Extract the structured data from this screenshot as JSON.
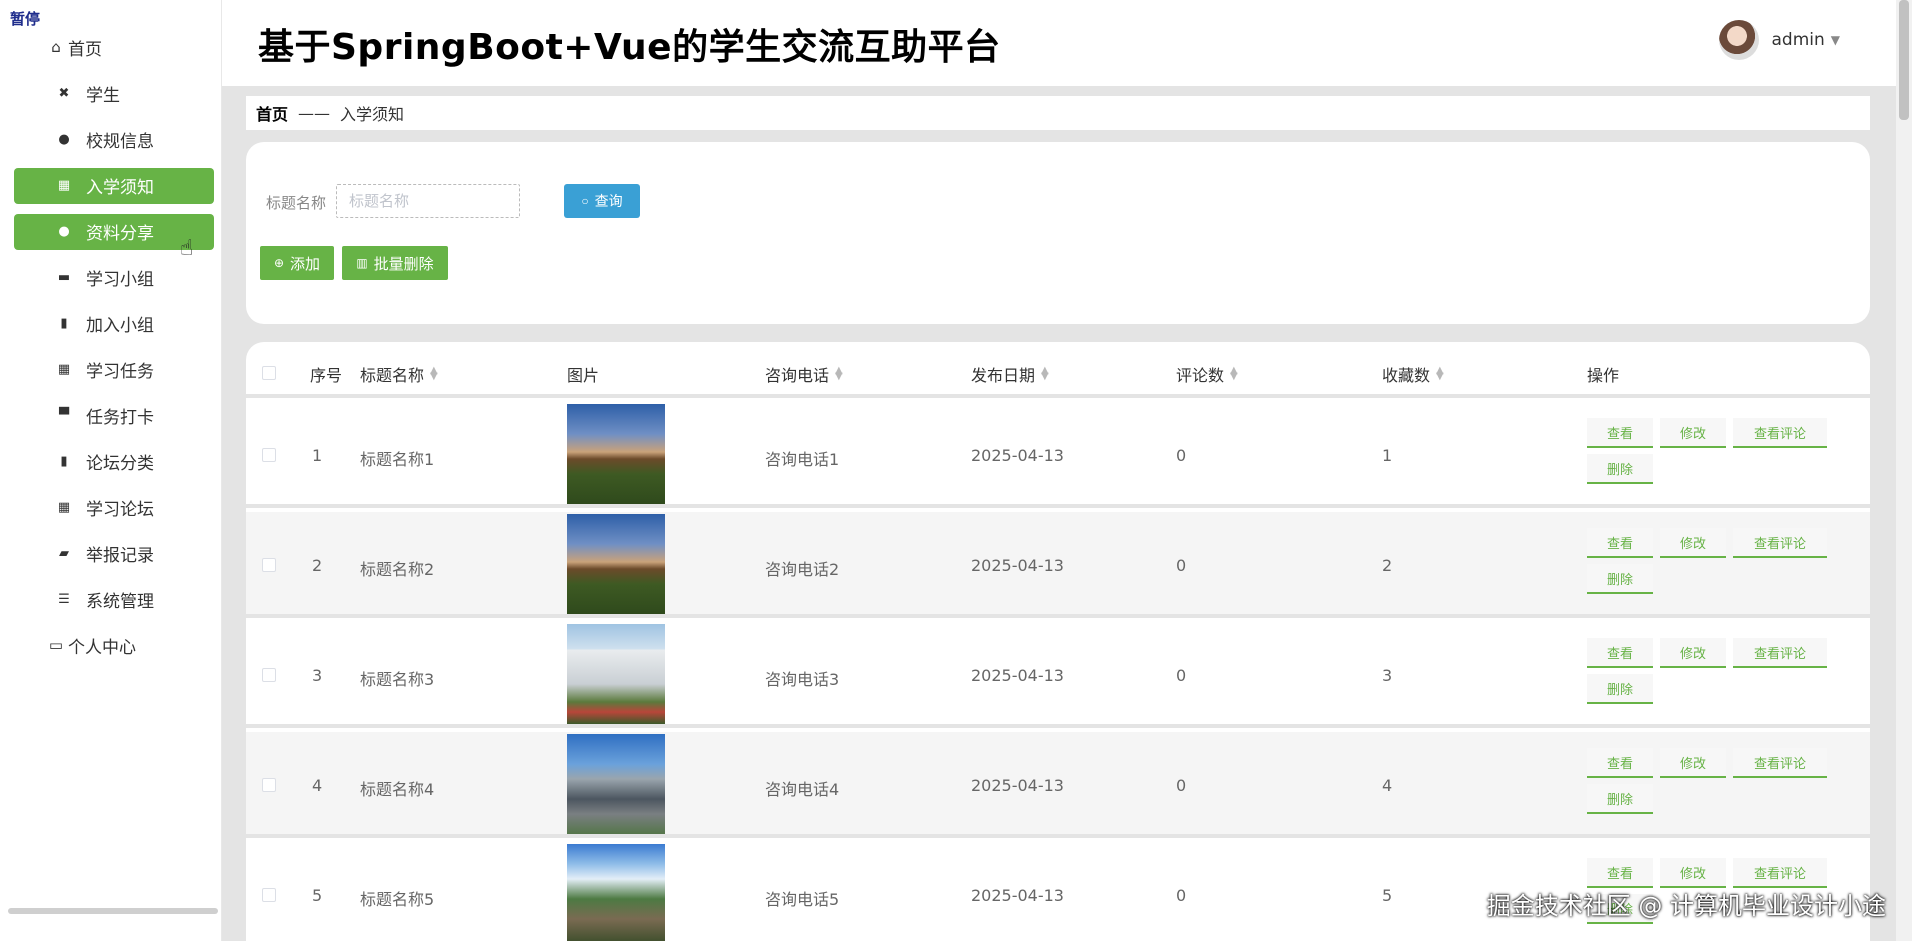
{
  "status_tag": "暂停",
  "header": {
    "title": "基于SpringBoot+Vue的学生交流互助平台",
    "user": "admin"
  },
  "sidebar": {
    "items": [
      {
        "label": "首页",
        "icon": "home-icon",
        "glyph": "⌂",
        "kind": "top"
      },
      {
        "label": "学生",
        "icon": "ticket-icon",
        "glyph": "✖",
        "kind": "sub"
      },
      {
        "label": "校规信息",
        "icon": "person-icon",
        "glyph": "●",
        "kind": "sub"
      },
      {
        "label": "入学须知",
        "icon": "grid-icon",
        "glyph": "▦",
        "kind": "sub",
        "active": true
      },
      {
        "label": "资料分享",
        "icon": "bulb-icon",
        "glyph": "●",
        "kind": "sub",
        "active": true
      },
      {
        "label": "学习小组",
        "icon": "briefcase-icon",
        "glyph": "▬",
        "kind": "sub"
      },
      {
        "label": "加入小组",
        "icon": "clipboard-icon",
        "glyph": "▮",
        "kind": "sub"
      },
      {
        "label": "学习任务",
        "icon": "grid-icon",
        "glyph": "▦",
        "kind": "sub"
      },
      {
        "label": "任务打卡",
        "icon": "monitor-icon",
        "glyph": "▀",
        "kind": "sub"
      },
      {
        "label": "论坛分类",
        "icon": "clipboard-check-icon",
        "glyph": "▮",
        "kind": "sub"
      },
      {
        "label": "学习论坛",
        "icon": "grid-icon",
        "glyph": "▦",
        "kind": "sub"
      },
      {
        "label": "举报记录",
        "icon": "wallet-icon",
        "glyph": "▰",
        "kind": "sub"
      },
      {
        "label": "系统管理",
        "icon": "list-icon",
        "glyph": "☰",
        "kind": "sub"
      },
      {
        "label": "个人中心",
        "icon": "window-icon",
        "glyph": "▭",
        "kind": "top"
      }
    ]
  },
  "breadcrumb": {
    "home": "首页",
    "separator": "——",
    "current": "入学须知"
  },
  "search": {
    "label": "标题名称",
    "placeholder": "标题名称",
    "query_button": "查询",
    "add_button": "添加",
    "batch_delete_button": "批量删除"
  },
  "table": {
    "columns": [
      "序号",
      "标题名称",
      "图片",
      "咨询电话",
      "发布日期",
      "评论数",
      "收藏数",
      "操作"
    ],
    "actions": {
      "view": "查看",
      "edit": "修改",
      "view_comments": "查看评论",
      "delete": "删除"
    },
    "rows": [
      {
        "index": "1",
        "title": "标题名称1",
        "phone": "咨询电话1",
        "date": "2025-04-13",
        "comments": "0",
        "favorites": "1",
        "image": "sky"
      },
      {
        "index": "2",
        "title": "标题名称2",
        "phone": "咨询电话2",
        "date": "2025-04-13",
        "comments": "0",
        "favorites": "2",
        "image": "sky"
      },
      {
        "index": "3",
        "title": "标题名称3",
        "phone": "咨询电话3",
        "date": "2025-04-13",
        "comments": "0",
        "favorites": "3",
        "image": "building"
      },
      {
        "index": "4",
        "title": "标题名称4",
        "phone": "咨询电话4",
        "date": "2025-04-13",
        "comments": "0",
        "favorites": "4",
        "image": "campus"
      },
      {
        "index": "5",
        "title": "标题名称5",
        "phone": "咨询电话5",
        "date": "2025-04-13",
        "comments": "0",
        "favorites": "5",
        "image": "gate"
      }
    ]
  },
  "watermark": "掘金技术社区 @ 计算机毕业设计小途"
}
